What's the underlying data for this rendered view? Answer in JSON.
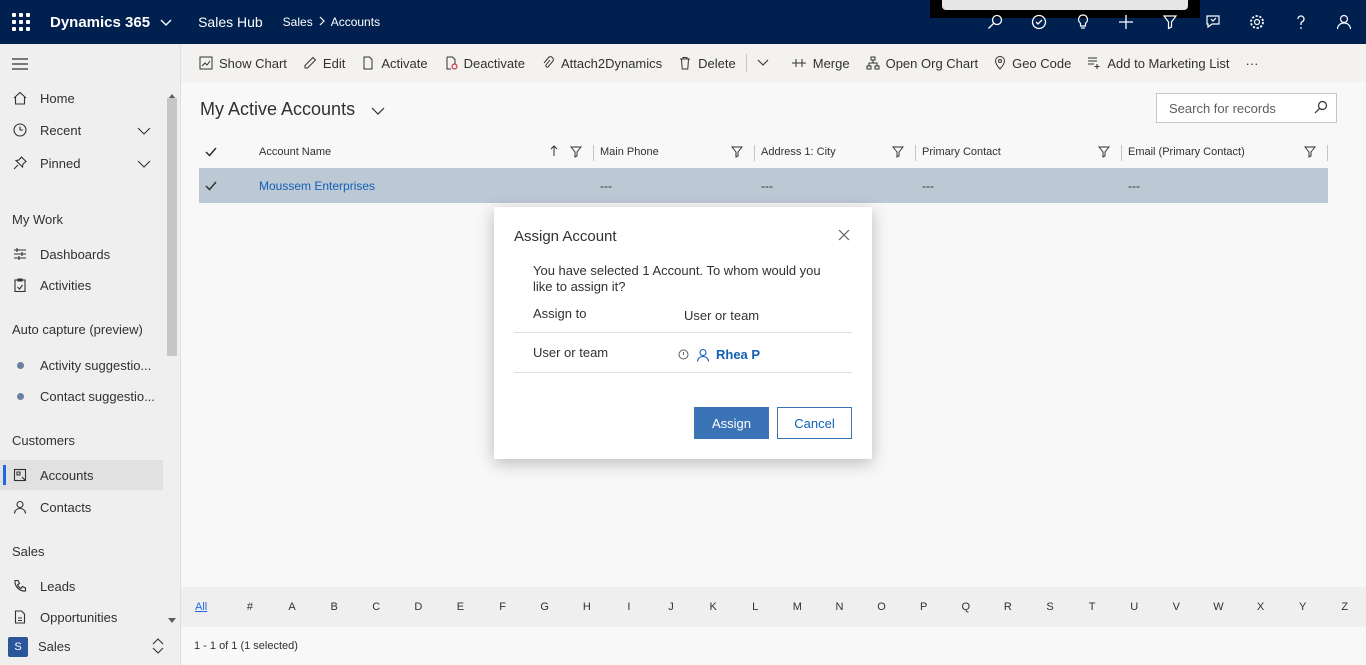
{
  "header": {
    "app_name": "Dynamics 365",
    "hub_name": "Sales Hub",
    "breadcrumbs": [
      "Sales",
      "Accounts"
    ],
    "icons": [
      "search-icon",
      "task-icon",
      "lightbulb-icon",
      "plus-icon",
      "filter-icon",
      "chat-icon",
      "gear-icon",
      "help-icon",
      "user-icon"
    ]
  },
  "sidebar": {
    "items": [
      {
        "label": "Home",
        "icon": "home-icon"
      },
      {
        "label": "Recent",
        "icon": "clock-icon"
      },
      {
        "label": "Pinned",
        "icon": "pin-icon"
      }
    ],
    "groups": {
      "my_work": "My Work",
      "auto_capture": "Auto capture (preview)",
      "customers": "Customers",
      "sales": "Sales"
    },
    "my_work_items": [
      {
        "label": "Dashboards",
        "icon": "dashboard-icon"
      },
      {
        "label": "Activities",
        "icon": "clipboard-icon"
      }
    ],
    "auto_capture_items": [
      {
        "label": "Activity suggestio..."
      },
      {
        "label": "Contact suggestio..."
      }
    ],
    "customer_items": [
      {
        "label": "Accounts",
        "icon": "building-icon"
      },
      {
        "label": "Contacts",
        "icon": "person-icon"
      }
    ],
    "sales_items": [
      {
        "label": "Leads",
        "icon": "phone-icon"
      },
      {
        "label": "Opportunities",
        "icon": "doc-icon"
      }
    ],
    "area": {
      "badge": "S",
      "label": "Sales"
    }
  },
  "commands": {
    "show_chart": "Show Chart",
    "edit": "Edit",
    "activate": "Activate",
    "deactivate": "Deactivate",
    "attach": "Attach2Dynamics",
    "delete": "Delete",
    "merge": "Merge",
    "org_chart": "Open Org Chart",
    "geo_code": "Geo Code",
    "marketing_list": "Add to Marketing List",
    "more": "···"
  },
  "view": {
    "title": "My Active Accounts",
    "search_placeholder": "Search for records"
  },
  "grid": {
    "columns": [
      "Account Name",
      "Main Phone",
      "Address 1: City",
      "Primary Contact",
      "Email (Primary Contact)"
    ],
    "rows": [
      {
        "account_name": "Moussem Enterprises",
        "main_phone": "---",
        "city": "---",
        "primary_contact": "---",
        "email": "---"
      }
    ]
  },
  "alphabet": [
    "All",
    "#",
    "A",
    "B",
    "C",
    "D",
    "E",
    "F",
    "G",
    "H",
    "I",
    "J",
    "K",
    "L",
    "M",
    "N",
    "O",
    "P",
    "Q",
    "R",
    "S",
    "T",
    "U",
    "V",
    "W",
    "X",
    "Y",
    "Z"
  ],
  "status": "1 - 1 of 1 (1 selected)",
  "dialog": {
    "title": "Assign Account",
    "message": "You have selected 1 Account. To whom would you like to assign it?",
    "assign_to_label": "Assign to",
    "assign_to_value": "User or team",
    "user_team_label": "User or team",
    "user_value": "Rhea P",
    "assign_button": "Assign",
    "cancel_button": "Cancel"
  },
  "colors": {
    "topbar": "#002050",
    "selected_row": "#bcc8d4",
    "primary_button": "#3a73b6",
    "link": "#1160b7"
  }
}
